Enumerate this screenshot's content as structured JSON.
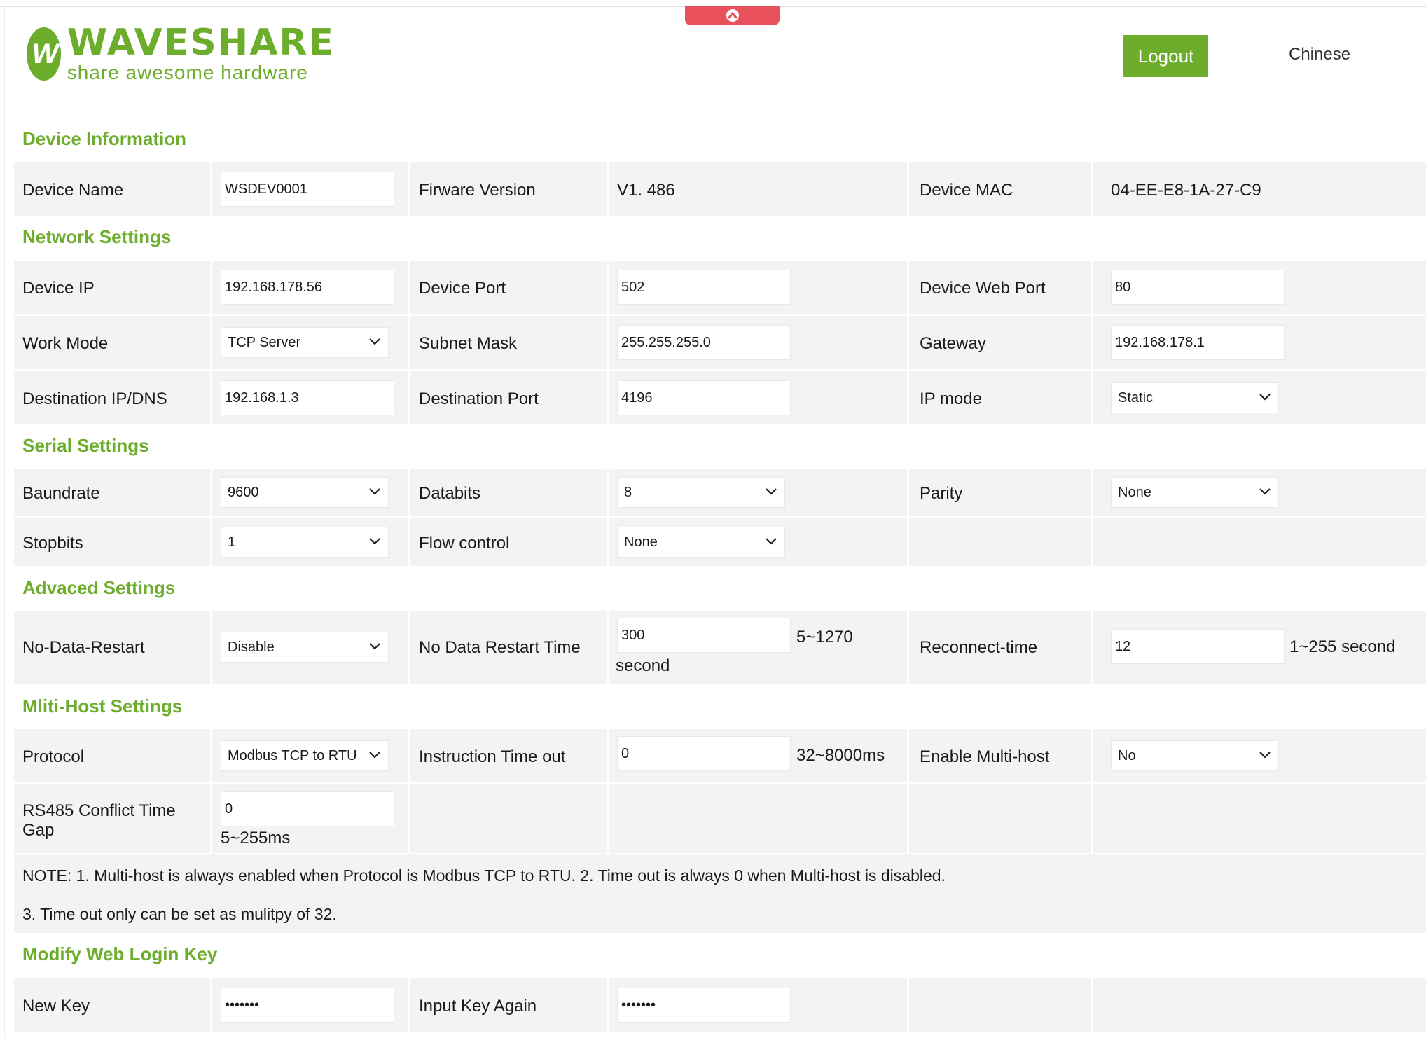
{
  "header": {
    "brand_name": "WAVESHARE",
    "brand_slogan": "share awesome hardware",
    "logo_mark": "W",
    "logout_label": "Logout",
    "language_link": "Chinese",
    "scroll_top_icon": "chevron-up-icon"
  },
  "colors": {
    "accent": "#6cad2c",
    "scroll_tab": "#e8505b",
    "cell_bg": "#f3f3f3"
  },
  "device_info": {
    "title": "Device Information",
    "device_name_label": "Device Name",
    "device_name_value": "WSDEV0001",
    "firmware_label": "Firware Version",
    "firmware_value": "V1. 486",
    "mac_label": "Device MAC",
    "mac_value": "04-EE-E8-1A-27-C9"
  },
  "network": {
    "title": "Network Settings",
    "device_ip_label": "Device IP",
    "device_ip_value": "192.168.178.56",
    "device_port_label": "Device Port",
    "device_port_value": "502",
    "web_port_label": "Device Web Port",
    "web_port_value": "80",
    "work_mode_label": "Work Mode",
    "work_mode_value": "TCP Server",
    "subnet_label": "Subnet Mask",
    "subnet_value": "255.255.255.0",
    "gateway_label": "Gateway",
    "gateway_value": "192.168.178.1",
    "dest_ip_label": "Destination IP/DNS",
    "dest_ip_value": "192.168.1.3",
    "dest_port_label": "Destination Port",
    "dest_port_value": "4196",
    "ip_mode_label": "IP mode",
    "ip_mode_value": "Static"
  },
  "serial": {
    "title": "Serial Settings",
    "baudrate_label": "Baundrate",
    "baudrate_value": "9600",
    "databits_label": "Databits",
    "databits_value": "8",
    "parity_label": "Parity",
    "parity_value": "None",
    "stopbits_label": "Stopbits",
    "stopbits_value": "1",
    "flow_label": "Flow control",
    "flow_value": "None"
  },
  "advanced": {
    "title": "Advaced Settings",
    "no_data_restart_label": "No-Data-Restart",
    "no_data_restart_value": "Disable",
    "restart_time_label": "No Data Restart Time",
    "restart_time_value": "300",
    "restart_time_range": "5~1270",
    "restart_time_unit": "second",
    "reconnect_label": "Reconnect-time",
    "reconnect_value": "12",
    "reconnect_range": "1~255 second"
  },
  "multi_host": {
    "title": "Mliti-Host Settings",
    "protocol_label": "Protocol",
    "protocol_value": "Modbus TCP to RTU",
    "instr_timeout_label": "Instruction Time out",
    "instr_timeout_value": "0",
    "instr_timeout_range": "32~8000ms",
    "enable_label": "Enable Multi-host",
    "enable_value": "No",
    "conflict_label_line1": "RS485 Conflict Time",
    "conflict_label_line2": "Gap",
    "conflict_value": "0",
    "conflict_range": "5~255ms",
    "note_line1": "NOTE: 1. Multi-host is always enabled when Protocol is Modbus TCP to RTU. 2. Time out is always 0 when Multi-host is disabled.",
    "note_line2": "3. Time out only can be set as mulitpy of 32."
  },
  "login_key": {
    "title": "Modify Web Login Key",
    "new_key_label": "New Key",
    "new_key_value": "•••••••",
    "again_label": "Input Key Again",
    "again_value": "•••••••"
  }
}
